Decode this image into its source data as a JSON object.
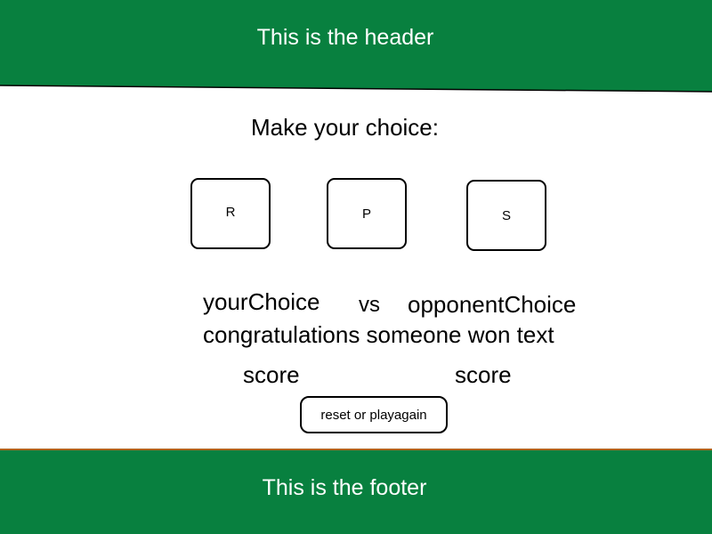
{
  "header": {
    "title": "This is the header"
  },
  "game": {
    "prompt": "Make your choice:",
    "choices": [
      {
        "label": "R"
      },
      {
        "label": "P"
      },
      {
        "label": "S"
      }
    ],
    "your_choice": "yourChoice",
    "vs": "vs",
    "opponent_choice": "opponentChoice",
    "result_text": "congratulations someone won text",
    "player_score": "score",
    "opponent_score": "score",
    "reset_label": "reset or playagain"
  },
  "footer": {
    "title": "This is the footer"
  },
  "colors": {
    "brand_green": "#08803f",
    "footer_border": "#b0641e"
  }
}
